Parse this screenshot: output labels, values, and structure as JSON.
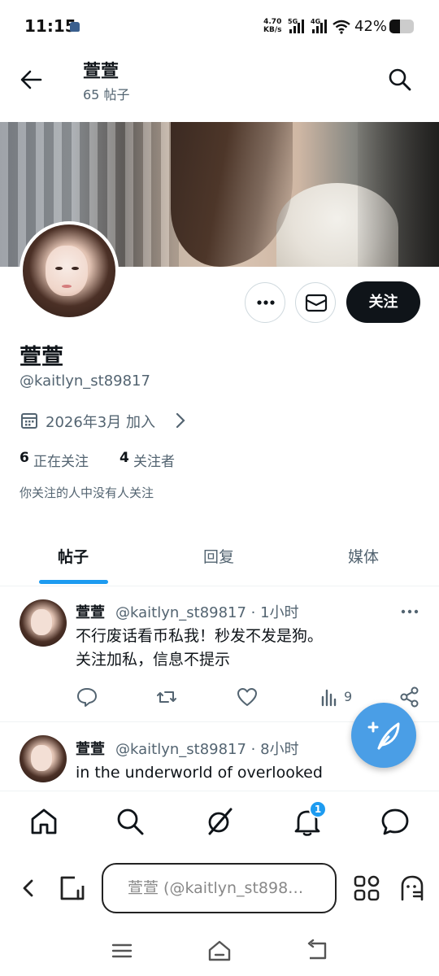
{
  "status_bar": {
    "time": "11:15",
    "net_speed_value": "4.70",
    "net_speed_unit": "KB/s",
    "sim1_label": "5G",
    "sim2_label": "4G",
    "battery": "42%",
    "battery_level": 0.42
  },
  "header": {
    "title": "萱萱",
    "post_count": "65 帖子"
  },
  "profile": {
    "name": "萱萱",
    "handle": "@kaitlyn_st89817",
    "joined": "2026年3月 加入",
    "following_count": "6",
    "following_label": "正在关注",
    "followers_count": "4",
    "followers_label": "关注者",
    "mutual_note": "你关注的人中没有人关注",
    "follow_button": "关注"
  },
  "tabs": [
    {
      "label": "帖子",
      "active": true
    },
    {
      "label": "回复",
      "active": false
    },
    {
      "label": "媒体",
      "active": false
    }
  ],
  "posts": [
    {
      "name": "萱萱",
      "meta": "@kaitlyn_st89817 · 1小时",
      "lines": [
        "不行废话看币私我！秒发不发是狗。",
        "关注加私，信息不提示"
      ],
      "views": "9"
    },
    {
      "name": "萱萱",
      "meta": "@kaitlyn_st89817 · 8小时",
      "lines": [
        "in the underworld of overlooked"
      ]
    }
  ],
  "bottom_nav": {
    "items": [
      "home-icon",
      "search-icon",
      "grok-icon",
      "notifications-icon",
      "messages-icon"
    ],
    "notification_badge": "1"
  },
  "browser": {
    "url_text": "萱萱 (@kaitlyn_st898…"
  },
  "colors": {
    "accent": "#1d9bf0",
    "fab": "#4a9ee6",
    "text_primary": "#0f1419",
    "text_secondary": "#536471"
  }
}
